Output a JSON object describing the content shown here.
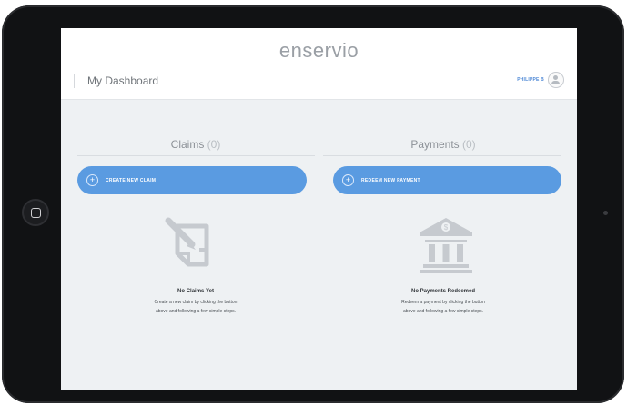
{
  "app": {
    "logo": "enservio"
  },
  "header": {
    "title": "My Dashboard",
    "user_name": "PHILIPPE B"
  },
  "claims": {
    "title": "Claims",
    "count": "(0)",
    "button_label": "CREATE NEW CLAIM",
    "empty_title": "No Claims Yet",
    "empty_desc_line1": "Create a new claim by clicking the button",
    "empty_desc_line2": "above and following a few simple steps.",
    "icon": "document-pen-icon"
  },
  "payments": {
    "title": "Payments",
    "count": "(0)",
    "button_label": "REDEEM NEW PAYMENT",
    "empty_title": "No Payments Redeemed",
    "empty_desc_line1": "Redeem a payment by clicking the button",
    "empty_desc_line2": "above and following a few simple steps.",
    "icon": "bank-icon"
  },
  "colors": {
    "accent": "#5a9be1",
    "background": "#eef1f3",
    "device": "#111214"
  }
}
